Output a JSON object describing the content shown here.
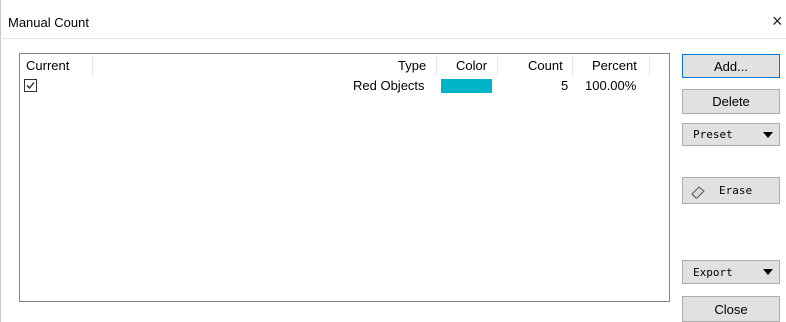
{
  "window": {
    "title": "Manual Count",
    "close_glyph": "×"
  },
  "table": {
    "columns": [
      "Current",
      "Type",
      "Color",
      "Count",
      "Percent"
    ],
    "rows": [
      {
        "current": true,
        "type": "Red Objects",
        "color": "#00b4c8",
        "count": "5",
        "percent": "100.00%"
      }
    ]
  },
  "buttons": {
    "add": "Add...",
    "delete": "Delete",
    "preset": "Preset",
    "erase": "Erase",
    "export": "Export",
    "close": "Close"
  },
  "icons": {
    "checkbox": "checkmark-icon",
    "erase": "eraser-icon",
    "dropdown": "chevron-down-icon",
    "close": "close-icon"
  },
  "colors": {
    "accent_border": "#0078d7",
    "button_bg": "#e1e1e1"
  }
}
